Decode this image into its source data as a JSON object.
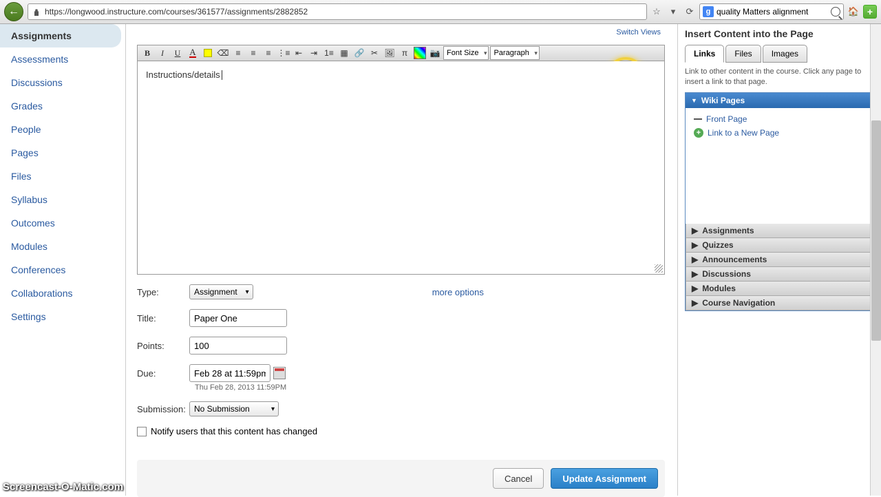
{
  "browser": {
    "url": "https://longwood.instructure.com/courses/361577/assignments/2882852",
    "search_text": "quality Matters alignment"
  },
  "sidebar": {
    "items": [
      "Assignments",
      "Assessments",
      "Discussions",
      "Grades",
      "People",
      "Pages",
      "Files",
      "Syllabus",
      "Outcomes",
      "Modules",
      "Conferences",
      "Collaborations",
      "Settings"
    ]
  },
  "editor": {
    "switch_views": "Switch Views",
    "font_size": "Font Size",
    "paragraph": "Paragraph",
    "content": "Instructions/details"
  },
  "form": {
    "type_label": "Type:",
    "type_value": "Assignment",
    "title_label": "Title:",
    "title_value": "Paper One",
    "points_label": "Points:",
    "points_value": "100",
    "due_label": "Due:",
    "due_value": "Feb 28 at 11:59pm",
    "due_sub": "Thu Feb 28, 2013 11:59PM",
    "submission_label": "Submission:",
    "submission_value": "No Submission",
    "more_options": "more options",
    "notify_label": "Notify users that this content has changed",
    "cancel": "Cancel",
    "update": "Update Assignment"
  },
  "rpanel": {
    "title": "Insert Content into the Page",
    "tabs": [
      "Links",
      "Files",
      "Images"
    ],
    "help": "Link to other content in the course. Click any page to insert a link to that page.",
    "wiki_header": "Wiki Pages",
    "wiki_items": {
      "front": "Front Page",
      "new": "Link to a New Page"
    },
    "sections": [
      "Assignments",
      "Quizzes",
      "Announcements",
      "Discussions",
      "Modules",
      "Course Navigation"
    ]
  },
  "watermark": "Screencast-O-Matic.com"
}
